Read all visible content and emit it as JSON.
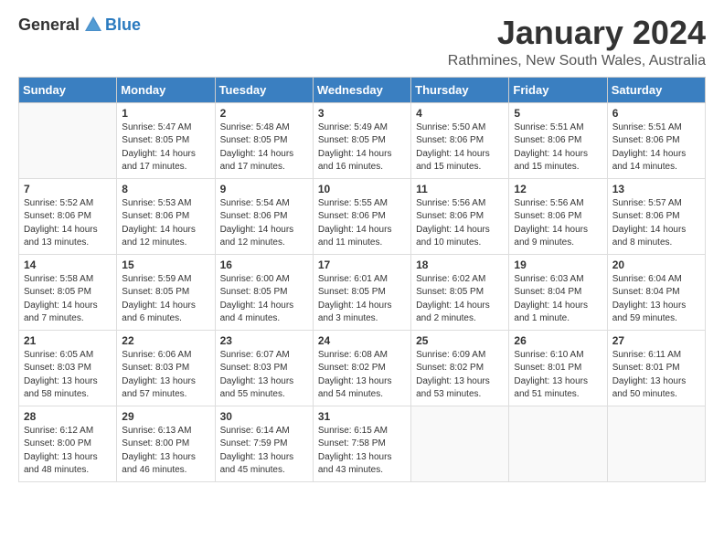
{
  "header": {
    "logo_general": "General",
    "logo_blue": "Blue",
    "title": "January 2024",
    "subtitle": "Rathmines, New South Wales, Australia"
  },
  "weekdays": [
    "Sunday",
    "Monday",
    "Tuesday",
    "Wednesday",
    "Thursday",
    "Friday",
    "Saturday"
  ],
  "weeks": [
    [
      {
        "day": "",
        "info": ""
      },
      {
        "day": "1",
        "info": "Sunrise: 5:47 AM\nSunset: 8:05 PM\nDaylight: 14 hours\nand 17 minutes."
      },
      {
        "day": "2",
        "info": "Sunrise: 5:48 AM\nSunset: 8:05 PM\nDaylight: 14 hours\nand 17 minutes."
      },
      {
        "day": "3",
        "info": "Sunrise: 5:49 AM\nSunset: 8:05 PM\nDaylight: 14 hours\nand 16 minutes."
      },
      {
        "day": "4",
        "info": "Sunrise: 5:50 AM\nSunset: 8:06 PM\nDaylight: 14 hours\nand 15 minutes."
      },
      {
        "day": "5",
        "info": "Sunrise: 5:51 AM\nSunset: 8:06 PM\nDaylight: 14 hours\nand 15 minutes."
      },
      {
        "day": "6",
        "info": "Sunrise: 5:51 AM\nSunset: 8:06 PM\nDaylight: 14 hours\nand 14 minutes."
      }
    ],
    [
      {
        "day": "7",
        "info": "Sunrise: 5:52 AM\nSunset: 8:06 PM\nDaylight: 14 hours\nand 13 minutes."
      },
      {
        "day": "8",
        "info": "Sunrise: 5:53 AM\nSunset: 8:06 PM\nDaylight: 14 hours\nand 12 minutes."
      },
      {
        "day": "9",
        "info": "Sunrise: 5:54 AM\nSunset: 8:06 PM\nDaylight: 14 hours\nand 12 minutes."
      },
      {
        "day": "10",
        "info": "Sunrise: 5:55 AM\nSunset: 8:06 PM\nDaylight: 14 hours\nand 11 minutes."
      },
      {
        "day": "11",
        "info": "Sunrise: 5:56 AM\nSunset: 8:06 PM\nDaylight: 14 hours\nand 10 minutes."
      },
      {
        "day": "12",
        "info": "Sunrise: 5:56 AM\nSunset: 8:06 PM\nDaylight: 14 hours\nand 9 minutes."
      },
      {
        "day": "13",
        "info": "Sunrise: 5:57 AM\nSunset: 8:06 PM\nDaylight: 14 hours\nand 8 minutes."
      }
    ],
    [
      {
        "day": "14",
        "info": "Sunrise: 5:58 AM\nSunset: 8:05 PM\nDaylight: 14 hours\nand 7 minutes."
      },
      {
        "day": "15",
        "info": "Sunrise: 5:59 AM\nSunset: 8:05 PM\nDaylight: 14 hours\nand 6 minutes."
      },
      {
        "day": "16",
        "info": "Sunrise: 6:00 AM\nSunset: 8:05 PM\nDaylight: 14 hours\nand 4 minutes."
      },
      {
        "day": "17",
        "info": "Sunrise: 6:01 AM\nSunset: 8:05 PM\nDaylight: 14 hours\nand 3 minutes."
      },
      {
        "day": "18",
        "info": "Sunrise: 6:02 AM\nSunset: 8:05 PM\nDaylight: 14 hours\nand 2 minutes."
      },
      {
        "day": "19",
        "info": "Sunrise: 6:03 AM\nSunset: 8:04 PM\nDaylight: 14 hours\nand 1 minute."
      },
      {
        "day": "20",
        "info": "Sunrise: 6:04 AM\nSunset: 8:04 PM\nDaylight: 13 hours\nand 59 minutes."
      }
    ],
    [
      {
        "day": "21",
        "info": "Sunrise: 6:05 AM\nSunset: 8:03 PM\nDaylight: 13 hours\nand 58 minutes."
      },
      {
        "day": "22",
        "info": "Sunrise: 6:06 AM\nSunset: 8:03 PM\nDaylight: 13 hours\nand 57 minutes."
      },
      {
        "day": "23",
        "info": "Sunrise: 6:07 AM\nSunset: 8:03 PM\nDaylight: 13 hours\nand 55 minutes."
      },
      {
        "day": "24",
        "info": "Sunrise: 6:08 AM\nSunset: 8:02 PM\nDaylight: 13 hours\nand 54 minutes."
      },
      {
        "day": "25",
        "info": "Sunrise: 6:09 AM\nSunset: 8:02 PM\nDaylight: 13 hours\nand 53 minutes."
      },
      {
        "day": "26",
        "info": "Sunrise: 6:10 AM\nSunset: 8:01 PM\nDaylight: 13 hours\nand 51 minutes."
      },
      {
        "day": "27",
        "info": "Sunrise: 6:11 AM\nSunset: 8:01 PM\nDaylight: 13 hours\nand 50 minutes."
      }
    ],
    [
      {
        "day": "28",
        "info": "Sunrise: 6:12 AM\nSunset: 8:00 PM\nDaylight: 13 hours\nand 48 minutes."
      },
      {
        "day": "29",
        "info": "Sunrise: 6:13 AM\nSunset: 8:00 PM\nDaylight: 13 hours\nand 46 minutes."
      },
      {
        "day": "30",
        "info": "Sunrise: 6:14 AM\nSunset: 7:59 PM\nDaylight: 13 hours\nand 45 minutes."
      },
      {
        "day": "31",
        "info": "Sunrise: 6:15 AM\nSunset: 7:58 PM\nDaylight: 13 hours\nand 43 minutes."
      },
      {
        "day": "",
        "info": ""
      },
      {
        "day": "",
        "info": ""
      },
      {
        "day": "",
        "info": ""
      }
    ]
  ]
}
